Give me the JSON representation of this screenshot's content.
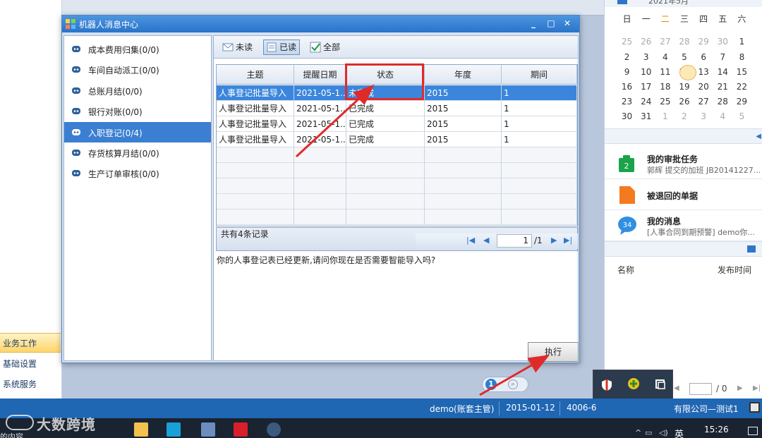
{
  "background": {
    "modules": [
      "业务工作",
      "基础设置",
      "系统服务"
    ],
    "active_module": "业务工作",
    "center_pager": {
      "page": "1"
    }
  },
  "calendar": {
    "title": "2021年5月",
    "weekdays": [
      "日",
      "一",
      "二",
      "三",
      "四",
      "五",
      "六"
    ],
    "rows": [
      [
        "25",
        "26",
        "27",
        "28",
        "29",
        "30",
        "1"
      ],
      [
        "2",
        "3",
        "4",
        "5",
        "6",
        "7",
        "8"
      ],
      [
        "9",
        "10",
        "11",
        "12",
        "13",
        "14",
        "15"
      ],
      [
        "16",
        "17",
        "18",
        "19",
        "20",
        "21",
        "22"
      ],
      [
        "23",
        "24",
        "25",
        "26",
        "27",
        "28",
        "29"
      ],
      [
        "30",
        "31",
        "1",
        "2",
        "3",
        "4",
        "5"
      ]
    ],
    "today": "12"
  },
  "portal": {
    "tasks": [
      {
        "title": "我的审批任务",
        "subtitle": "郭辉 提交的加班 JB20141227...",
        "badge": "2",
        "color": "#1aa34a"
      },
      {
        "title": "被退回的单据",
        "subtitle": "",
        "badge": "",
        "color": "#f47a20"
      },
      {
        "title": "我的消息",
        "subtitle": "[人事合同到期预警] demo你...",
        "badge": "34",
        "color": "#2f8fe0"
      }
    ],
    "notice_cols": {
      "name": "名称",
      "time": "发布时间"
    },
    "pager_text": "/ 0"
  },
  "dialog": {
    "title": "机器人消息中心",
    "window_buttons": {
      "minimize": "_",
      "maximize": "□",
      "close": "✕"
    },
    "categories": [
      {
        "label": "成本费用归集(0/0)",
        "selected": false
      },
      {
        "label": "车间自动派工(0/0)",
        "selected": false
      },
      {
        "label": "总账月结(0/0)",
        "selected": false
      },
      {
        "label": "银行对账(0/0)",
        "selected": false
      },
      {
        "label": "入职登记(0/4)",
        "selected": true
      },
      {
        "label": "存货核算月结(0/0)",
        "selected": false
      },
      {
        "label": "生产订单审核(0/0)",
        "selected": false
      }
    ],
    "toolbar": {
      "unread": "未读",
      "read": "已读",
      "all": "全部"
    },
    "grid": {
      "columns": [
        "主题",
        "提醒日期",
        "状态",
        "年度",
        "期间"
      ],
      "rows": [
        [
          "人事登记批量导入",
          "2021-05-1...",
          "未完成",
          "2015",
          "1"
        ],
        [
          "人事登记批量导入",
          "2021-05-1...",
          "已完成",
          "2015",
          "1"
        ],
        [
          "人事登记批量导入",
          "2021-05-1...",
          "已完成",
          "2015",
          "1"
        ],
        [
          "人事登记批量导入",
          "2021-05-1...",
          "已完成",
          "2015",
          "1"
        ]
      ],
      "selected_row": 0
    },
    "footer": {
      "count_text": "共有4条记录",
      "page": "1",
      "total": "/1"
    },
    "message": "你的人事登记表已经更新,请问你现在是否需要智能导入吗?",
    "execute_label": "执行"
  },
  "statusbar": {
    "user": "demo(账套主管)",
    "date": "2015-01-12",
    "phone": "4006-6",
    "company": "有限公司—测试1"
  },
  "taskbar": {
    "clock": "15:26",
    "ime": "英",
    "left_text": "的内容"
  },
  "watermark": "大数跨境",
  "colors": {
    "accent": "#2a74c9",
    "selection": "#3b86dc",
    "annotation": "#e02a2a"
  }
}
